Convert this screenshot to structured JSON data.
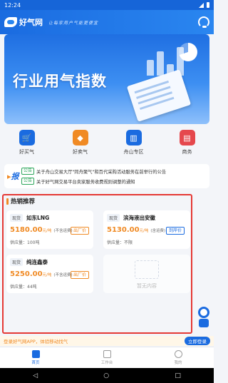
{
  "status_bar": {
    "time": "12:24"
  },
  "header": {
    "logo_text": "好气网",
    "slogan": "让每家用户气能更便宜"
  },
  "banner": {
    "title": "行业用气指数"
  },
  "quick_nav": [
    {
      "label": "好买气",
      "icon": "cart-icon",
      "color": "#1a6be0"
    },
    {
      "label": "好卖气",
      "icon": "tag-icon",
      "color": "#f08a24"
    },
    {
      "label": "舟山专区",
      "icon": "building-icon",
      "color": "#1a6be0"
    },
    {
      "label": "商务",
      "icon": "document-icon",
      "color": "#e5484d"
    }
  ],
  "notice": {
    "items": [
      {
        "tag": "公告",
        "text": "关于舟山交易大厅\"同舟聚气\"和百代采购活动服务在前举行的公告"
      },
      {
        "tag": "公告",
        "text": "关于好气网交易平台卖家服务收费规则调整的通知"
      }
    ]
  },
  "hot_sale": {
    "title": "热销推荐",
    "cards": [
      {
        "type": "现货",
        "name": "如东LNG",
        "price": "5180.00",
        "unit": "元/吨",
        "tax": "(不含运费)",
        "button": "出厂价",
        "supply": "供应量：100吨"
      },
      {
        "type": "现货",
        "name": "滨海液出安徽",
        "price": "5130.00",
        "unit": "元/吨",
        "tax": "(含运费)",
        "button": "到岸价",
        "supply": "供应量：不限"
      },
      {
        "type": "现货",
        "name": "纯连鑫泰",
        "price": "5250.00",
        "unit": "元/吨",
        "tax": "(不含运费)",
        "button": "出厂价",
        "supply": "供应量：44吨"
      }
    ],
    "empty_text": "暂无内容"
  },
  "login_bar": {
    "text": "登录好气网APP，体验移动找气",
    "button": "立即登录"
  },
  "tab_bar": [
    {
      "label": "首页",
      "active": true
    },
    {
      "label": "工作台",
      "active": false
    },
    {
      "label": "我的",
      "active": false
    }
  ],
  "system_nav": {
    "back": "◁",
    "home": "○",
    "recent": "□"
  }
}
